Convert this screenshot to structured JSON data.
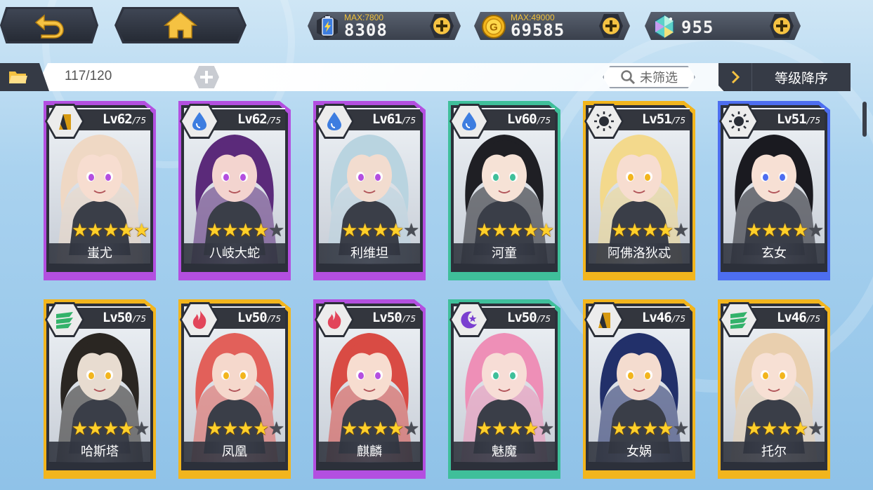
{
  "header": {
    "back_icon": "back-arrow-icon",
    "home_icon": "home-icon",
    "resources": [
      {
        "name": "stamina",
        "icon": "battery-icon",
        "max_label": "MAX:7800",
        "value": "8308"
      },
      {
        "name": "gold",
        "icon": "gold-coin-icon",
        "max_label": "MAX:49000",
        "value": "69585"
      },
      {
        "name": "crystal",
        "icon": "crystal-icon",
        "max_label": "",
        "value": "955"
      }
    ]
  },
  "toolbar": {
    "capacity": "117/120",
    "filter_label": "未筛选",
    "sort_label": "等级降序"
  },
  "colors": {
    "purple": "#b34fe0",
    "teal": "#3fbf9a",
    "yellow": "#f2b51d",
    "blue": "#4d6ef0"
  },
  "cards": [
    {
      "name": "蚩尤",
      "level": "Lv62",
      "max": "/75",
      "stars": 5,
      "element": "earth",
      "rarity_color": "#b34fe0",
      "hair": "#efd8c4",
      "skin": "#f7ddd0"
    },
    {
      "name": "八岐大蛇",
      "level": "Lv62",
      "max": "/75",
      "stars": 4,
      "element": "water",
      "rarity_color": "#b34fe0",
      "hair": "#5b2a7a",
      "skin": "#f3d4cf"
    },
    {
      "name": "利维坦",
      "level": "Lv61",
      "max": "/75",
      "stars": 4,
      "element": "water",
      "rarity_color": "#b34fe0",
      "hair": "#b9d4e0",
      "skin": "#f2dccf"
    },
    {
      "name": "河童",
      "level": "Lv60",
      "max": "/75",
      "stars": 5,
      "element": "water",
      "rarity_color": "#3fbf9a",
      "hair": "#1f1f24",
      "skin": "#f6e2d6"
    },
    {
      "name": "阿佛洛狄忒",
      "level": "Lv51",
      "max": "/75",
      "stars": 4,
      "element": "light",
      "rarity_color": "#f2b51d",
      "hair": "#f3d98c",
      "skin": "#f7ddd0"
    },
    {
      "name": "玄女",
      "level": "Lv51",
      "max": "/75",
      "stars": 4,
      "element": "light",
      "rarity_color": "#4d6ef0",
      "hair": "#1a1a20",
      "skin": "#f7e0d4"
    },
    {
      "name": "哈斯塔",
      "level": "Lv50",
      "max": "/75",
      "stars": 4,
      "element": "wind",
      "rarity_color": "#f2b51d",
      "hair": "#2a2622",
      "skin": "#e8dcd0"
    },
    {
      "name": "凤凰",
      "level": "Lv50",
      "max": "/75",
      "stars": 4,
      "element": "fire",
      "rarity_color": "#f2b51d",
      "hair": "#e2605a",
      "skin": "#f5d8cc"
    },
    {
      "name": "麒麟",
      "level": "Lv50",
      "max": "/75",
      "stars": 4,
      "element": "fire",
      "rarity_color": "#b34fe0",
      "hair": "#d94b44",
      "skin": "#f7ddd0"
    },
    {
      "name": "魅魔",
      "level": "Lv50",
      "max": "/75",
      "stars": 4,
      "element": "dark",
      "rarity_color": "#3fbf9a",
      "hair": "#ee8fb7",
      "skin": "#f7ddd6"
    },
    {
      "name": "女娲",
      "level": "Lv46",
      "max": "/75",
      "stars": 4,
      "element": "earth",
      "rarity_color": "#f2b51d",
      "hair": "#22306a",
      "skin": "#f4dccf"
    },
    {
      "name": "托尔",
      "level": "Lv46",
      "max": "/75",
      "stars": 4,
      "element": "wind",
      "rarity_color": "#f2b51d",
      "hair": "#e9cfae",
      "skin": "#f7e0d4"
    }
  ]
}
